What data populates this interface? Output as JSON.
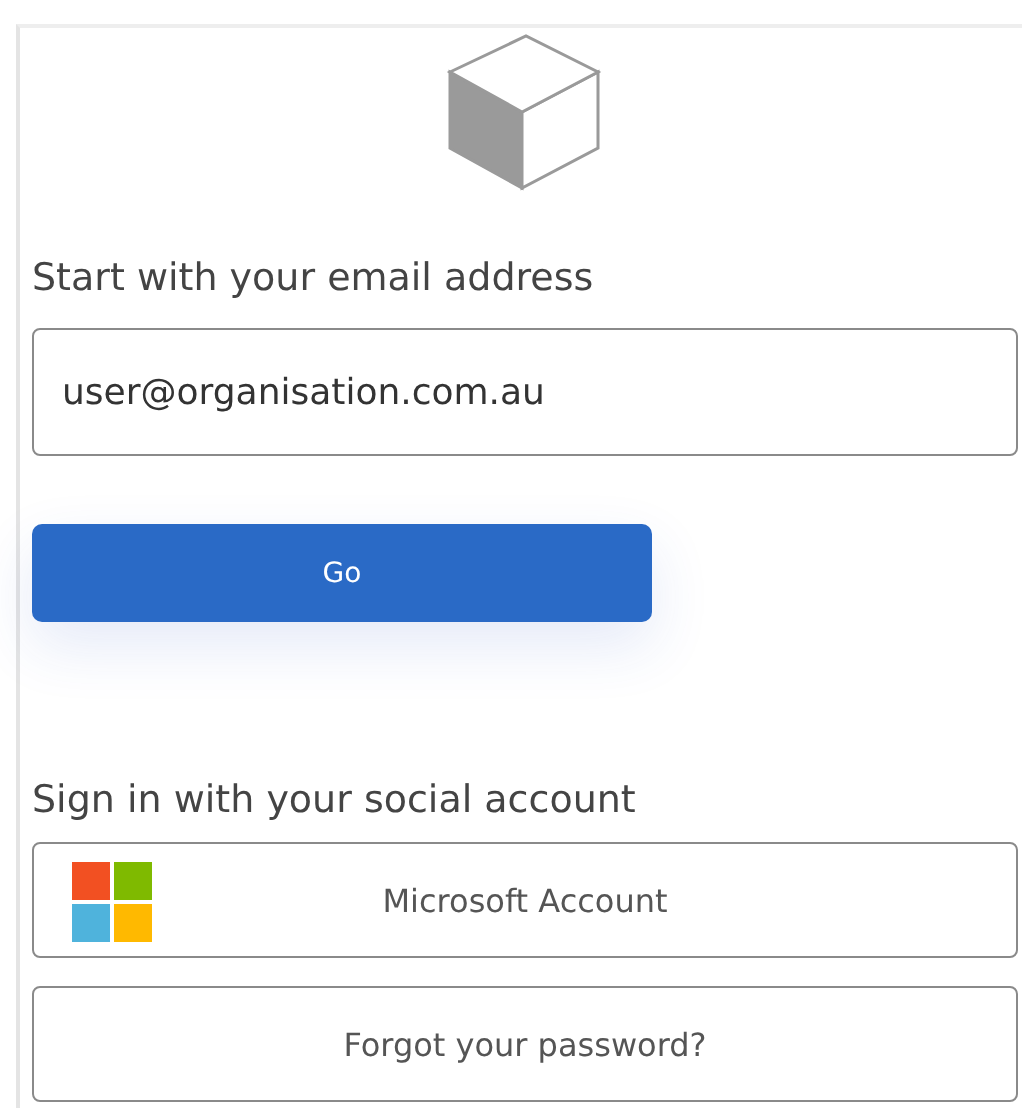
{
  "email_section": {
    "heading": "Start with your email address",
    "email_field": {
      "value": "user@organisation.com.au"
    },
    "submit_button": "Go"
  },
  "social_section": {
    "heading": "Sign in with your social account",
    "buttons": [
      {
        "kind": "microsoft",
        "label": "Microsoft Account"
      },
      {
        "kind": "plain",
        "label": "Forgot your password?"
      }
    ]
  }
}
